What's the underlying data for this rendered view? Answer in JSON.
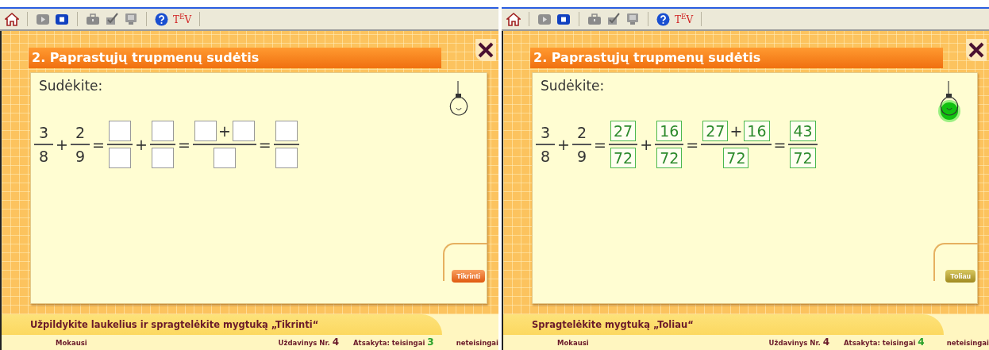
{
  "panels": [
    {
      "toolbar": {
        "tev": "T$^{E}$V"
      },
      "title": "2. Paprastųjų trupmenų sudėtis",
      "prompt": "Sudėkite:",
      "bulb": {
        "lit": false
      },
      "equation": [
        {
          "kind": "given",
          "num": "3",
          "den": "8"
        },
        {
          "kind": "sign",
          "text": "+"
        },
        {
          "kind": "given",
          "num": "2",
          "den": "9"
        },
        {
          "kind": "sign",
          "text": "="
        },
        {
          "kind": "answer",
          "num": [
            {
              "kind": "box",
              "correct": false
            }
          ],
          "den": [
            {
              "kind": "box",
              "correct": false
            }
          ]
        },
        {
          "kind": "sign",
          "text": "+"
        },
        {
          "kind": "answer",
          "num": [
            {
              "kind": "box",
              "correct": false
            }
          ],
          "den": [
            {
              "kind": "box",
              "correct": false
            }
          ]
        },
        {
          "kind": "sign",
          "text": "="
        },
        {
          "kind": "answer",
          "num": [
            {
              "kind": "box",
              "correct": false
            },
            {
              "kind": "sign",
              "text": "+"
            },
            {
              "kind": "box",
              "correct": false
            }
          ],
          "den": [
            {
              "kind": "box",
              "correct": false
            }
          ]
        },
        {
          "kind": "sign",
          "text": "="
        },
        {
          "kind": "answer",
          "num": [
            {
              "kind": "box",
              "correct": false
            }
          ],
          "den": [
            {
              "kind": "box",
              "correct": false
            }
          ]
        }
      ],
      "button": {
        "kind": "check",
        "label": "Tikrinti"
      },
      "instruction": "Užpildykite laukelius ir spragtelėkite mygtuką „Tikrinti“",
      "status": {
        "mode": "Mokausi",
        "task_label": "Uždavinys Nr.",
        "task_number": "4",
        "correct_label": "Atsakyta: teisingai",
        "correct_count": "3",
        "wrong_label": "neteisingai"
      }
    },
    {
      "toolbar": {
        "tev": "T$^{E}$V"
      },
      "title": "2. Paprastųjų trupmenų sudėtis",
      "prompt": "Sudėkite:",
      "bulb": {
        "lit": true
      },
      "equation": [
        {
          "kind": "given",
          "num": "3",
          "den": "8"
        },
        {
          "kind": "sign",
          "text": "+"
        },
        {
          "kind": "given",
          "num": "2",
          "den": "9"
        },
        {
          "kind": "sign",
          "text": "="
        },
        {
          "kind": "answer",
          "num": [
            {
              "kind": "box",
              "correct": true,
              "value": "27"
            }
          ],
          "den": [
            {
              "kind": "box",
              "correct": true,
              "value": "72"
            }
          ]
        },
        {
          "kind": "sign",
          "text": "+"
        },
        {
          "kind": "answer",
          "num": [
            {
              "kind": "box",
              "correct": true,
              "value": "16"
            }
          ],
          "den": [
            {
              "kind": "box",
              "correct": true,
              "value": "72"
            }
          ]
        },
        {
          "kind": "sign",
          "text": "="
        },
        {
          "kind": "answer",
          "num": [
            {
              "kind": "box",
              "correct": true,
              "value": "27"
            },
            {
              "kind": "sign",
              "text": "+"
            },
            {
              "kind": "box",
              "correct": true,
              "value": "16"
            }
          ],
          "den": [
            {
              "kind": "box",
              "correct": true,
              "value": "72"
            }
          ]
        },
        {
          "kind": "sign",
          "text": "="
        },
        {
          "kind": "answer",
          "num": [
            {
              "kind": "box",
              "correct": true,
              "value": "43"
            }
          ],
          "den": [
            {
              "kind": "box",
              "correct": true,
              "value": "72"
            }
          ]
        }
      ],
      "button": {
        "kind": "next",
        "label": "Toliau"
      },
      "instruction": "Spragtelėkite mygtuką „Toliau“",
      "status": {
        "mode": "Mokausi",
        "task_label": "Uždavinys Nr.",
        "task_number": "4",
        "correct_label": "Atsakyta: teisingai",
        "correct_count": "4",
        "wrong_label": "neteisingai"
      }
    }
  ]
}
